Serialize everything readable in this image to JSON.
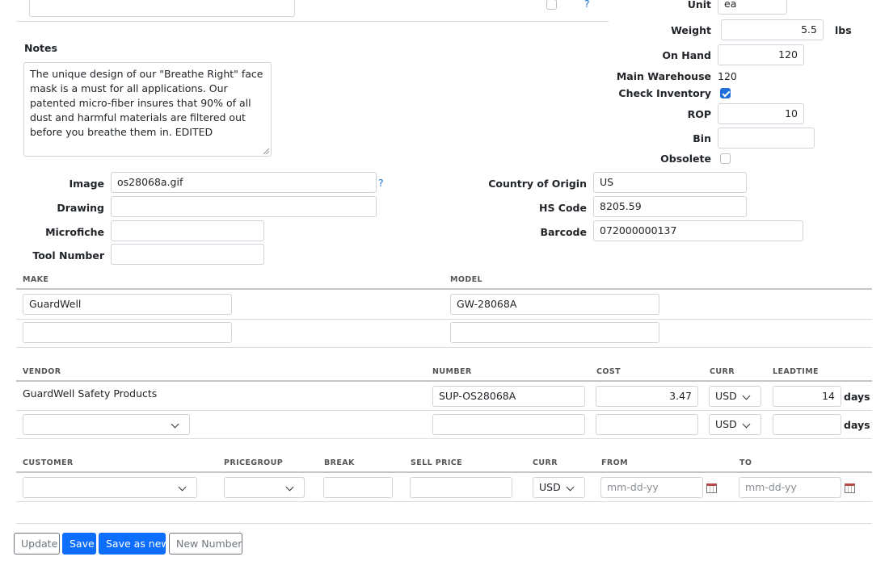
{
  "top": {
    "unit_label": "Unit",
    "unit_value": "ea",
    "weight_label": "Weight",
    "weight_value": "5.5",
    "weight_unit": "lbs",
    "onhand_label": "On Hand",
    "onhand_value": "120",
    "main_warehouse_label": "Main Warehouse",
    "main_warehouse_value": "120",
    "check_inventory_label": "Check Inventory",
    "check_inventory_checked": true,
    "rop_label": "ROP",
    "rop_value": "10",
    "bin_label": "Bin",
    "bin_value": "",
    "obsolete_label": "Obsolete",
    "obsolete_checked": false,
    "help_glyph": "?"
  },
  "notes": {
    "label": "Notes",
    "text": "The unique design of our \"Breathe Right\" face mask is a must for all applications. Our patented micro-fiber insures that 90% of all dust and harmful materials are filtered out before you breathe them in. EDITED"
  },
  "fields": {
    "image_label": "Image",
    "image_value": "os28068a.gif",
    "drawing_label": "Drawing",
    "drawing_value": "",
    "microfiche_label": "Microfiche",
    "microfiche_value": "",
    "tool_number_label": "Tool Number",
    "tool_number_value": "",
    "country_label": "Country of Origin",
    "country_value": "US",
    "hs_code_label": "HS Code",
    "hs_code_value": "8205.59",
    "barcode_label": "Barcode",
    "barcode_value": "072000000137"
  },
  "make_model": {
    "headers": {
      "make": "MAKE",
      "model": "MODEL"
    },
    "rows": [
      {
        "make": "GuardWell",
        "model": "GW-28068A"
      },
      {
        "make": "",
        "model": ""
      }
    ]
  },
  "vendors": {
    "headers": {
      "vendor": "VENDOR",
      "number": "NUMBER",
      "cost": "COST",
      "curr": "CURR",
      "leadtime": "LEADTIME"
    },
    "days_label": "days",
    "rows": [
      {
        "vendor": "GuardWell Safety Products",
        "number": "SUP-OS28068A",
        "cost": "3.47",
        "curr": "USD",
        "leadtime": "14"
      },
      {
        "vendor": "",
        "number": "",
        "cost": "",
        "curr": "USD",
        "leadtime": ""
      }
    ]
  },
  "pricing": {
    "headers": {
      "customer": "CUSTOMER",
      "pricegroup": "PRICEGROUP",
      "break": "BREAK",
      "sell_price": "SELL PRICE",
      "curr": "CURR",
      "from": "FROM",
      "to": "TO"
    },
    "row": {
      "customer": "",
      "pricegroup": "",
      "break": "",
      "sell_price": "",
      "curr": "USD",
      "from_placeholder": "mm-dd-yy",
      "to_placeholder": "mm-dd-yy"
    }
  },
  "buttons": {
    "update": "Update",
    "save": "Save",
    "save_as_new": "Save as new",
    "new_number": "New Number"
  },
  "colors": {
    "primary": "#0d6efd",
    "link": "#1a73c8",
    "check": "#1e6fd9"
  }
}
